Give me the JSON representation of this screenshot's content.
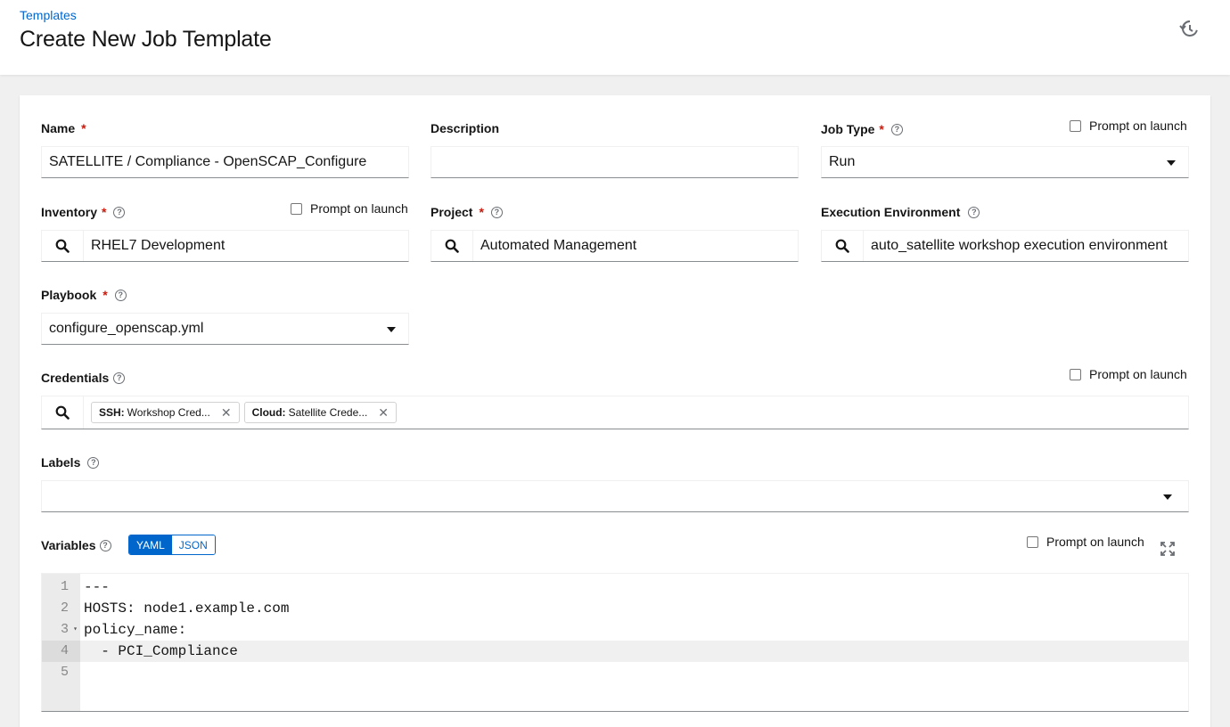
{
  "breadcrumb": "Templates",
  "page_title": "Create New Job Template",
  "icons": {
    "history": "history-icon",
    "search": "search-icon",
    "expand": "expand-icon",
    "help": "help-icon",
    "close": "close-icon"
  },
  "form": {
    "name": {
      "label": "Name",
      "value": "SATELLITE / Compliance - OpenSCAP_Configure"
    },
    "description": {
      "label": "Description",
      "value": ""
    },
    "job_type": {
      "label": "Job Type",
      "value": "Run",
      "prompt": "Prompt on launch"
    },
    "inventory": {
      "label": "Inventory",
      "value": "RHEL7 Development",
      "prompt": "Prompt on launch"
    },
    "project": {
      "label": "Project",
      "value": "Automated Management"
    },
    "execution_environment": {
      "label": "Execution Environment",
      "value": "auto_satellite workshop execution environment"
    },
    "playbook": {
      "label": "Playbook",
      "value": "configure_openscap.yml"
    },
    "credentials": {
      "label": "Credentials",
      "prompt": "Prompt on launch",
      "chips": [
        {
          "type": "SSH:",
          "name": "Workshop Cred..."
        },
        {
          "type": "Cloud:",
          "name": "Satellite Crede..."
        }
      ]
    },
    "labels": {
      "label": "Labels",
      "value": ""
    },
    "variables": {
      "label": "Variables",
      "prompt": "Prompt on launch",
      "mode_yaml": "YAML",
      "mode_json": "JSON",
      "lines": [
        {
          "n": "1",
          "text": "---"
        },
        {
          "n": "2",
          "text": "HOSTS: node1.example.com"
        },
        {
          "n": "3",
          "text": "policy_name:"
        },
        {
          "n": "4",
          "text": "  - PCI_Compliance"
        },
        {
          "n": "5",
          "text": ""
        }
      ]
    }
  },
  "colors": {
    "link": "#0066cc",
    "required": "#c9190b",
    "toggle_active": "#0066cc"
  }
}
